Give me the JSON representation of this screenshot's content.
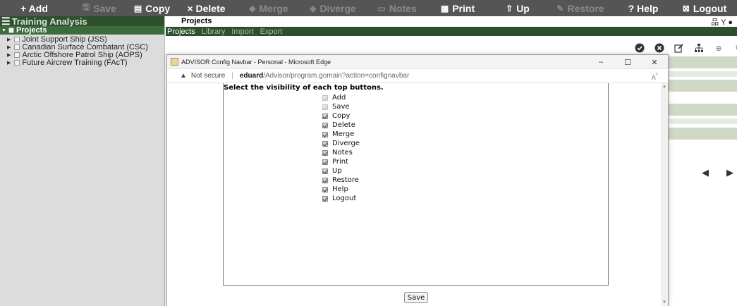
{
  "topnav": {
    "buttons": [
      {
        "label": "+ Add",
        "icon": "plus-icon",
        "enabled": true
      },
      {
        "label": "Save",
        "icon": "floppy-icon",
        "enabled": false
      },
      {
        "label": "Copy",
        "icon": "copy-icon",
        "enabled": true
      },
      {
        "label": "× Delete",
        "icon": "x-icon",
        "enabled": true
      },
      {
        "label": "Merge",
        "icon": "merge-icon",
        "enabled": false
      },
      {
        "label": "Diverge",
        "icon": "diverge-icon",
        "enabled": false
      },
      {
        "label": "Notes",
        "icon": "notes-icon",
        "enabled": false
      },
      {
        "label": "Print",
        "icon": "printer-icon",
        "enabled": true
      },
      {
        "label": "Up",
        "icon": "up-arrow-icon",
        "enabled": false
      },
      {
        "label": "Restore",
        "icon": "restore-icon",
        "enabled": false
      },
      {
        "label": "? Help",
        "icon": "help-icon",
        "enabled": true
      },
      {
        "label": "Logout",
        "icon": "logout-icon",
        "enabled": true
      }
    ]
  },
  "leftpanel": {
    "title": "Training Analysis",
    "root": "Projects",
    "items": [
      "Joint Support Ship (JSS)",
      "Canadian Surface Combatant (CSC)",
      "Arctic Offshore Patrol Ship (AOPS)",
      "Future Aircrew Training (FAcT)"
    ]
  },
  "main": {
    "title": "Projects",
    "tabs": [
      "Projects",
      "Library",
      "Import",
      "Export"
    ],
    "active_tab": "Projects"
  },
  "popup": {
    "window_title": "ADVISOR Config Navbar - Personal - Microsoft Edge",
    "controls": [
      "–",
      "☐",
      "✕"
    ],
    "security_label": "Not secure",
    "url_host": "eduard",
    "url_path": "/Advisor/program.gomain?action=confignavbar",
    "heading": "Select the visibility of each top buttons.",
    "options": [
      {
        "label": "Add",
        "checked": true,
        "enabled": false
      },
      {
        "label": "Save",
        "checked": true,
        "enabled": false
      },
      {
        "label": "Copy",
        "checked": true,
        "enabled": true
      },
      {
        "label": "Delete",
        "checked": true,
        "enabled": true
      },
      {
        "label": "Merge",
        "checked": true,
        "enabled": true
      },
      {
        "label": "Diverge",
        "checked": true,
        "enabled": true
      },
      {
        "label": "Notes",
        "checked": true,
        "enabled": true
      },
      {
        "label": "Print",
        "checked": true,
        "enabled": true
      },
      {
        "label": "Up",
        "checked": true,
        "enabled": true
      },
      {
        "label": "Restore",
        "checked": true,
        "enabled": true
      },
      {
        "label": "Help",
        "checked": true,
        "enabled": true
      },
      {
        "label": "Logout",
        "checked": true,
        "enabled": true
      }
    ],
    "save_label": "Save"
  },
  "colors": {
    "navbar": "#555555",
    "panel_header": "#2e4f2e",
    "tree_root": "#3c6b3c",
    "left_bg": "#dcdcdc"
  }
}
